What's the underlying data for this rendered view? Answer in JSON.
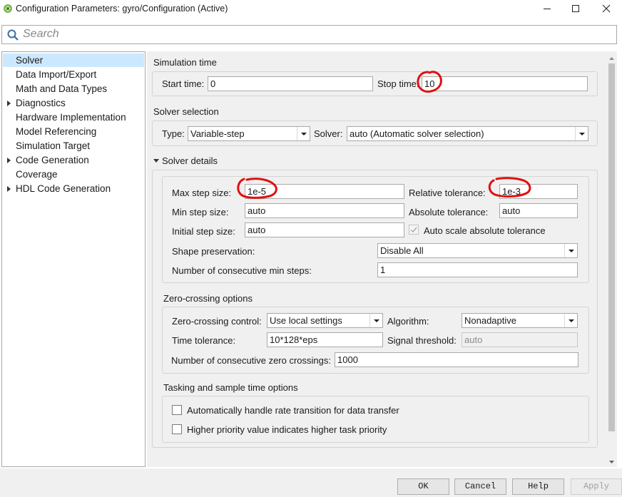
{
  "window": {
    "title": "Configuration Parameters: gyro/Configuration (Active)"
  },
  "search": {
    "placeholder": "Search",
    "value": ""
  },
  "tree": {
    "items": [
      {
        "label": "Solver",
        "selected": true,
        "expandable": false
      },
      {
        "label": "Data Import/Export",
        "selected": false,
        "expandable": false
      },
      {
        "label": "Math and Data Types",
        "selected": false,
        "expandable": false
      },
      {
        "label": "Diagnostics",
        "selected": false,
        "expandable": true
      },
      {
        "label": "Hardware Implementation",
        "selected": false,
        "expandable": false
      },
      {
        "label": "Model Referencing",
        "selected": false,
        "expandable": false
      },
      {
        "label": "Simulation Target",
        "selected": false,
        "expandable": false
      },
      {
        "label": "Code Generation",
        "selected": false,
        "expandable": true
      },
      {
        "label": "Coverage",
        "selected": false,
        "expandable": false
      },
      {
        "label": "HDL Code Generation",
        "selected": false,
        "expandable": true
      }
    ]
  },
  "simulation_time": {
    "title": "Simulation time",
    "start_label": "Start time:",
    "start_value": "0",
    "stop_label": "Stop time:",
    "stop_value": "10"
  },
  "solver_selection": {
    "title": "Solver selection",
    "type_label": "Type:",
    "type_value": "Variable-step",
    "solver_label": "Solver:",
    "solver_value": "auto (Automatic solver selection)"
  },
  "solver_details": {
    "title": "Solver details",
    "max_step_label": "Max step size:",
    "max_step_value": "1e-5",
    "min_step_label": "Min step size:",
    "min_step_value": "auto",
    "initial_step_label": "Initial step size:",
    "initial_step_value": "auto",
    "rel_tol_label": "Relative tolerance:",
    "rel_tol_value": "1e-3",
    "abs_tol_label": "Absolute tolerance:",
    "abs_tol_value": "auto",
    "auto_scale_label": "Auto scale absolute tolerance",
    "auto_scale_checked": true,
    "shape_label": "Shape preservation:",
    "shape_value": "Disable All",
    "consec_min_label": "Number of consecutive min steps:",
    "consec_min_value": "1"
  },
  "zero_crossing": {
    "title": "Zero-crossing options",
    "control_label": "Zero-crossing control:",
    "control_value": "Use local settings",
    "algorithm_label": "Algorithm:",
    "algorithm_value": "Nonadaptive",
    "time_tol_label": "Time tolerance:",
    "time_tol_value": "10*128*eps",
    "signal_threshold_label": "Signal threshold:",
    "signal_threshold_value": "auto",
    "consec_zc_label": "Number of consecutive zero crossings:",
    "consec_zc_value": "1000"
  },
  "tasking": {
    "title": "Tasking and sample time options",
    "rate_transition_label": "Automatically handle rate transition for data transfer",
    "rate_transition_checked": false,
    "priority_label": "Higher priority value indicates higher task priority",
    "priority_checked": false
  },
  "buttons": {
    "ok": "OK",
    "cancel": "Cancel",
    "help": "Help",
    "apply": "Apply"
  },
  "colors": {
    "selection": "#cce8ff",
    "panel_bg": "#f0f0f0",
    "annotation_red": "#e01010"
  }
}
